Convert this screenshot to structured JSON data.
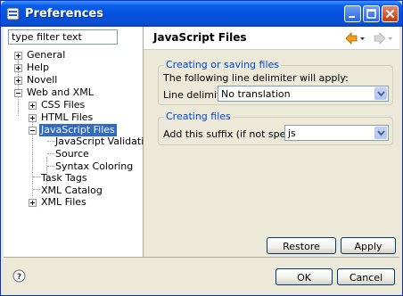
{
  "window": {
    "title": "Preferences"
  },
  "filter": {
    "placeholder": "type filter text",
    "value": "type filter text"
  },
  "tree": {
    "general": "General",
    "help": "Help",
    "novell": "Novell",
    "web_and_xml": "Web and XML",
    "css_files": "CSS Files",
    "html_files": "HTML Files",
    "javascript_files": "JavaScript Files",
    "js_validation": "JavaScript Validation",
    "source": "Source",
    "syntax_coloring": "Syntax Coloring",
    "task_tags": "Task Tags",
    "xml_catalog": "XML Catalog",
    "xml_files": "XML Files"
  },
  "page": {
    "title": "JavaScript Files"
  },
  "saving_group": {
    "legend": "Creating or saving files",
    "description": "The following line delimiter will apply:",
    "delimiter_label": "Line delimiter:",
    "delimiter_value": "No translation"
  },
  "creating_group": {
    "legend": "Creating files",
    "suffix_label": "Add this suffix (if not specified):",
    "suffix_value": "js"
  },
  "buttons": {
    "restore_defaults": "Restore Defaults",
    "apply": "Apply",
    "ok": "OK",
    "cancel": "Cancel"
  },
  "icons": {
    "app": "preferences-icon",
    "minimize": "minimize-icon",
    "maximize": "maximize-icon",
    "close": "close-icon",
    "back": "back-arrow-icon",
    "forward": "forward-arrow-icon",
    "help": "help-icon"
  },
  "colors": {
    "titlebar": "#0550dc",
    "selection": "#316ac5",
    "group_legend": "#0046d5",
    "back_arrow": "#f0a020"
  }
}
